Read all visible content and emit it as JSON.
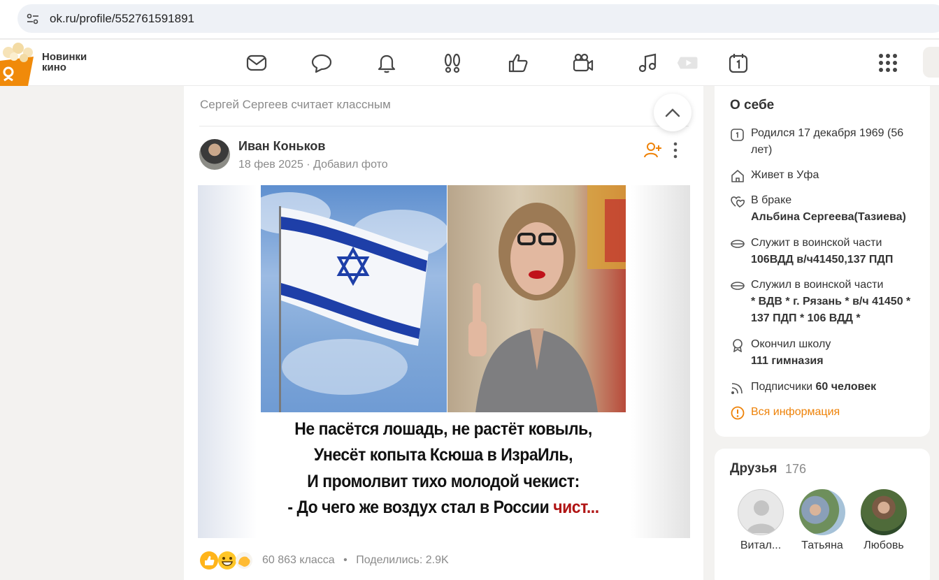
{
  "browser": {
    "url": "ok.ru/profile/552761591891"
  },
  "header": {
    "promo_line1": "Новинки",
    "promo_line2": "кино",
    "nav_icons": [
      "messages-icon",
      "discussions-icon",
      "notifications-icon",
      "guests-icon",
      "likes-icon",
      "video-icon",
      "music-icon",
      "video-play-icon",
      "calendar-icon",
      "apps-grid-icon"
    ]
  },
  "feed": {
    "liked_by_line": "Сергей Сергеев считает классным",
    "post": {
      "author": "Иван Коньков",
      "date": "18 фев 2025",
      "action": "Добавил фото",
      "meta_separator": "·",
      "caption_lines": [
        "Не пасётся лошадь, не растёт ковыль,",
        "Унесёт копыта Ксюша в ИзраИль,",
        "И промолвит тихо молодой чекист:",
        "- До чего же воздух стал в России"
      ],
      "caption_red": "чист...",
      "reactions_text": "60 863 класса",
      "dot": "•",
      "shares_text": "Поделились: 2.9K"
    }
  },
  "about": {
    "title": "О себе",
    "born": "Родился 17 декабря 1969 (56 лет)",
    "lives": "Живет в Уфа",
    "married_label": "В браке",
    "married_to": "Альбина Сергеева(Тазиева)",
    "serves_label": "Служит в воинской части",
    "serves_value": "106ВДД в/ч41450,137 ПДП",
    "served_label": "Служил в воинской части",
    "served_value": "* ВДВ * г. Рязань * в/ч 41450 * 137 ПДП * 106 ВДД *",
    "school_label": "Окончил школу",
    "school_value": "111 гимназия",
    "subscribers_label": "Подписчики",
    "subscribers_value": "60 человек",
    "all_info": "Вся информация"
  },
  "friends": {
    "title": "Друзья",
    "count": "176",
    "items": [
      {
        "name": "Витал..."
      },
      {
        "name": "Татьяна"
      },
      {
        "name": "Любовь"
      }
    ]
  },
  "colors": {
    "accent": "#ee8208",
    "caption_red": "#b01414",
    "flag_blue": "#1e3fa8"
  }
}
